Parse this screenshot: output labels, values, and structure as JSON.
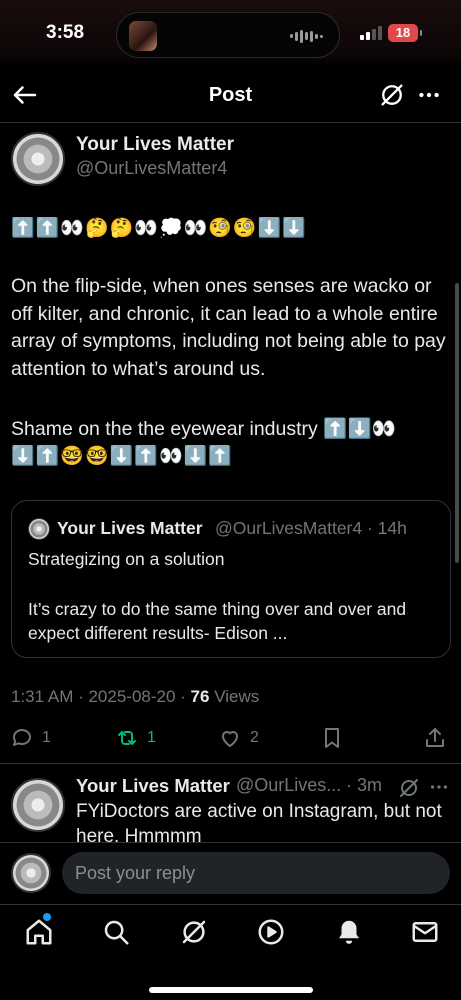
{
  "status_bar": {
    "time": "3:58",
    "battery": "18"
  },
  "header": {
    "title": "Post"
  },
  "post": {
    "name": "Your Lives Matter",
    "handle": "@OurLivesMatter4",
    "emoji_line": "⬆️⬆️👀🤔🤔👀💭👀🧐🧐⬇️⬇️",
    "body": "On the flip-side, when ones senses are wacko or off kilter, and chronic, it can lead to a whole entire array of symptoms, including not being able to pay attention to what’s around us.",
    "line2": "Shame on the the eyewear industry ⬆️⬇️👀",
    "line3": "⬇️⬆️🤓🤓⬇️⬆️👀⬇️⬆️",
    "quote": {
      "name": "Your Lives Matter",
      "handle_time": "@OurLivesMatter4 · 14h",
      "line1": "Strategizing on a solution",
      "body": "It’s crazy to do the same thing over and over and expect different results- Edison ..."
    },
    "meta": {
      "datetime": "1:31 AM · 2025-08-20 · ",
      "views_count": "76",
      "views_label": " Views"
    },
    "actions": {
      "replies": "1",
      "reposts": "1",
      "likes": "2"
    }
  },
  "reply": {
    "name": "Your Lives Matter",
    "handle": "@OurLives...",
    "time": "· 3m",
    "text": "FYiDoctors are active on Instagram, but not here. Hmmmm"
  },
  "reply_bar": {
    "placeholder": "Post your reply"
  },
  "colors": {
    "background": "#000000",
    "text": "#e7e9ea",
    "muted": "#71767b",
    "repost_green": "#00ba7c",
    "accent_blue": "#1d9bf0",
    "border": "#2f3336"
  },
  "icons": [
    "back-arrow-icon",
    "grok-icon",
    "more-icon",
    "reply-icon",
    "repost-icon",
    "like-icon",
    "bookmark-icon",
    "share-icon",
    "home-icon",
    "search-icon",
    "play-icon",
    "bell-icon",
    "mail-icon"
  ]
}
